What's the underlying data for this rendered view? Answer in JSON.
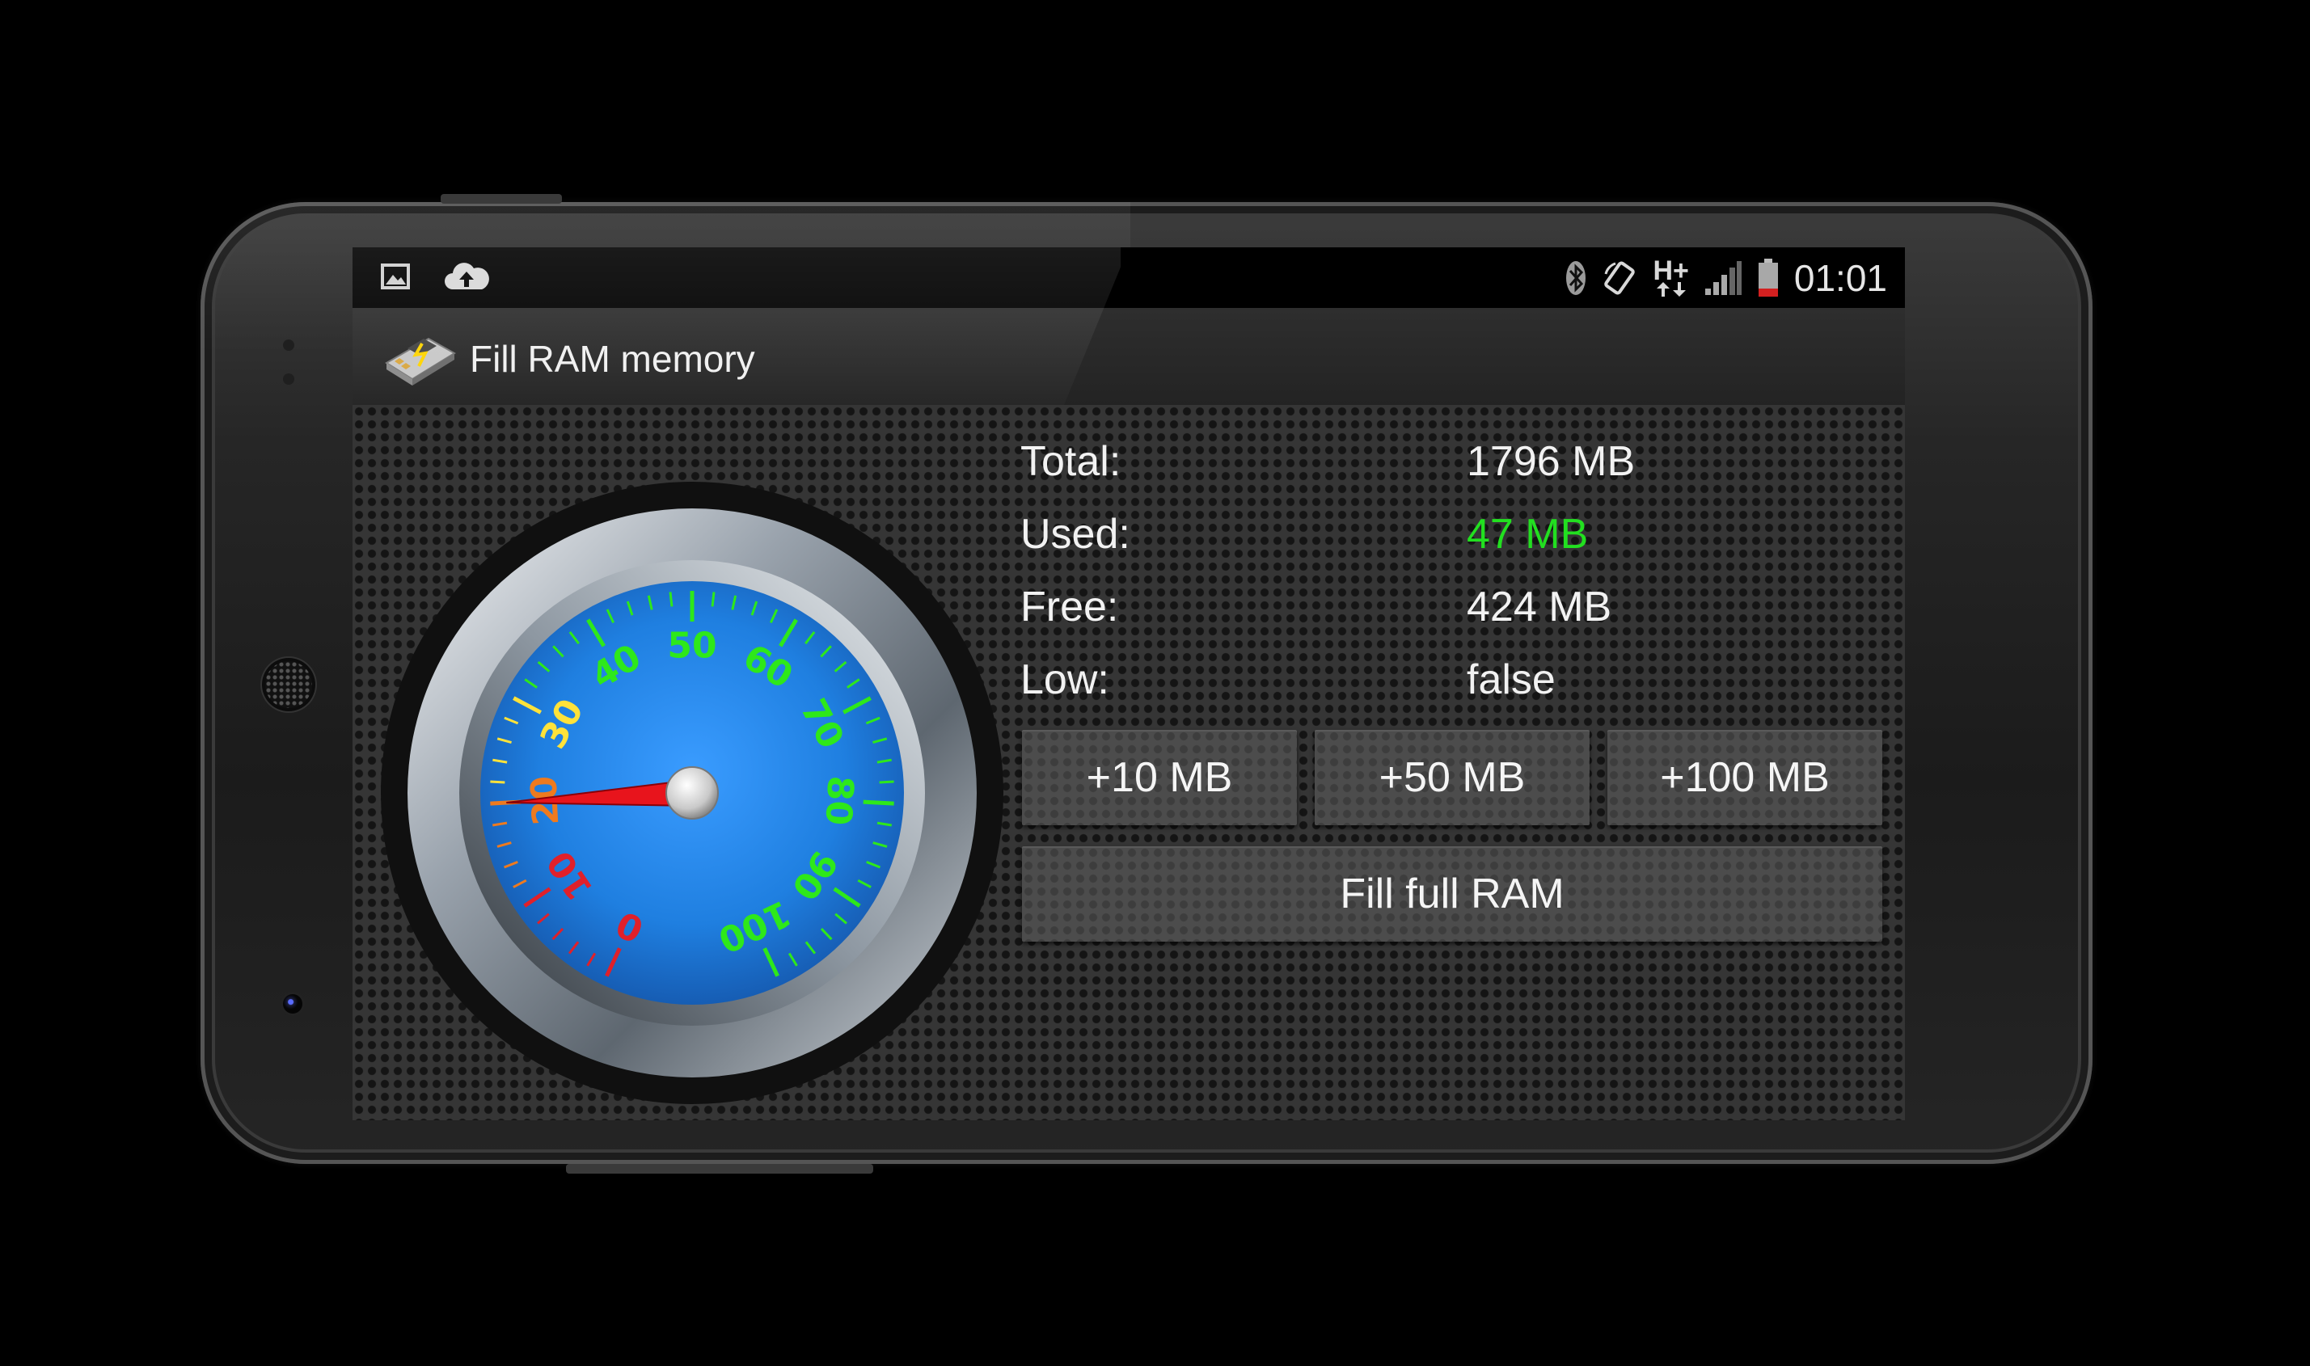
{
  "status_bar": {
    "left_icons": [
      "image-icon",
      "cloud-upload-icon"
    ],
    "right_icons": [
      "bluetooth-icon",
      "screen-rotation-icon",
      "hplus-data-icon",
      "signal-icon",
      "battery-low-icon"
    ],
    "network_type": "H+",
    "time": "01:01",
    "battery_color": "#d32020"
  },
  "action_bar": {
    "app_icon": "memory-card-icon",
    "title": "Fill RAM memory"
  },
  "gauge": {
    "labels": [
      "0",
      "10",
      "20",
      "30",
      "40",
      "50",
      "60",
      "70",
      "80",
      "90",
      "100"
    ],
    "min": 0,
    "max": 100,
    "needle_value": 20,
    "label_colors": {
      "red": "#e0202a",
      "orange": "#ee7a1e",
      "yellow": "#ffe23a",
      "green": "#2ee81a"
    },
    "dial_color": "#1f7fe0"
  },
  "memory": {
    "total_label": "Total:",
    "total_value": "1796 MB",
    "used_label": "Used:",
    "used_value": "47 MB",
    "used_color": "#22e020",
    "free_label": "Free:",
    "free_value": "424 MB",
    "low_label": "Low:",
    "low_value": "false"
  },
  "buttons": {
    "add_10": "+10 MB",
    "add_50": "+50 MB",
    "add_100": "+100 MB",
    "fill_full": "Fill full RAM"
  }
}
